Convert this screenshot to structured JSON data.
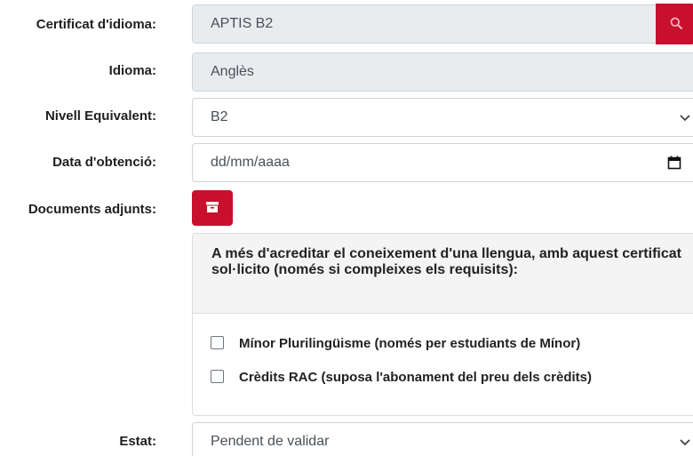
{
  "form": {
    "certificate": {
      "label": "Certificat d'idioma:",
      "value": "APTIS B2"
    },
    "language": {
      "label": "Idioma:",
      "value": "Anglès"
    },
    "level": {
      "label": "Nivell Equivalent:",
      "value": "B2"
    },
    "date": {
      "label": "Data d'obtenció:",
      "placeholder": "dd/mm/aaaa"
    },
    "documents": {
      "label": "Documents adjunts:"
    },
    "extra_panel": {
      "heading": "A més d'acreditar el coneixement d'una llengua, amb aquest certificat sol·licito (només si compleixes els requisits):",
      "options": [
        {
          "label": "Mínor Plurilingüisme (només per estudiants de Mínor)",
          "checked": false
        },
        {
          "label": "Crèdits RAC (suposa l'abonament del preu dels crèdits)",
          "checked": false
        }
      ]
    },
    "status": {
      "label": "Estat:",
      "value": "Pendent de validar"
    }
  },
  "icons": {
    "search": "search-icon",
    "archive": "archive-icon",
    "calendar": "calendar-icon",
    "chevron": "chevron-down-icon"
  },
  "colors": {
    "accent": "#c8102e",
    "readonly_bg": "#e9ecef",
    "panel_header_bg": "#f4f4f5"
  }
}
